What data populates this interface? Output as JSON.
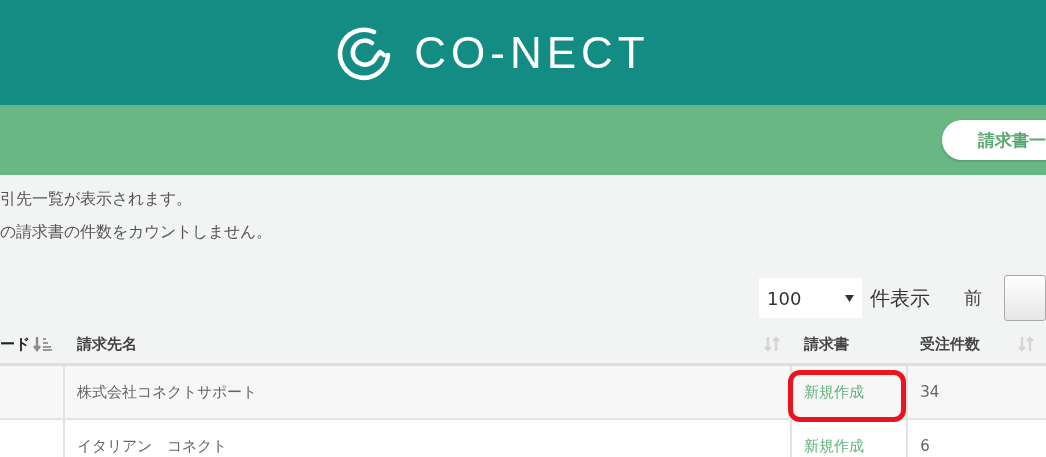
{
  "header": {
    "logo_text": "CO-NECT"
  },
  "nav": {
    "button": "請求書一"
  },
  "notes": [
    "引先一覧が表示されます。",
    "の請求書の件数をカウントしません。"
  ],
  "controls": {
    "page_size": "100",
    "page_size_label": "件表示",
    "prev": "前"
  },
  "table": {
    "columns": [
      {
        "label": "ード",
        "sortable": true,
        "sorted": true
      },
      {
        "label": "請求先名",
        "sortable": true,
        "sorted": false
      },
      {
        "label": "請求書",
        "sortable": false
      },
      {
        "label": "受注件数",
        "sortable": true,
        "sorted": false
      }
    ],
    "rows": [
      {
        "name": "株式会社コネクトサポート",
        "invoice": "新規作成",
        "orders": "34",
        "highlighted": true
      },
      {
        "name": "イタリアン　コネクト",
        "invoice": "新規作成",
        "orders": "6",
        "highlighted": false
      }
    ]
  }
}
